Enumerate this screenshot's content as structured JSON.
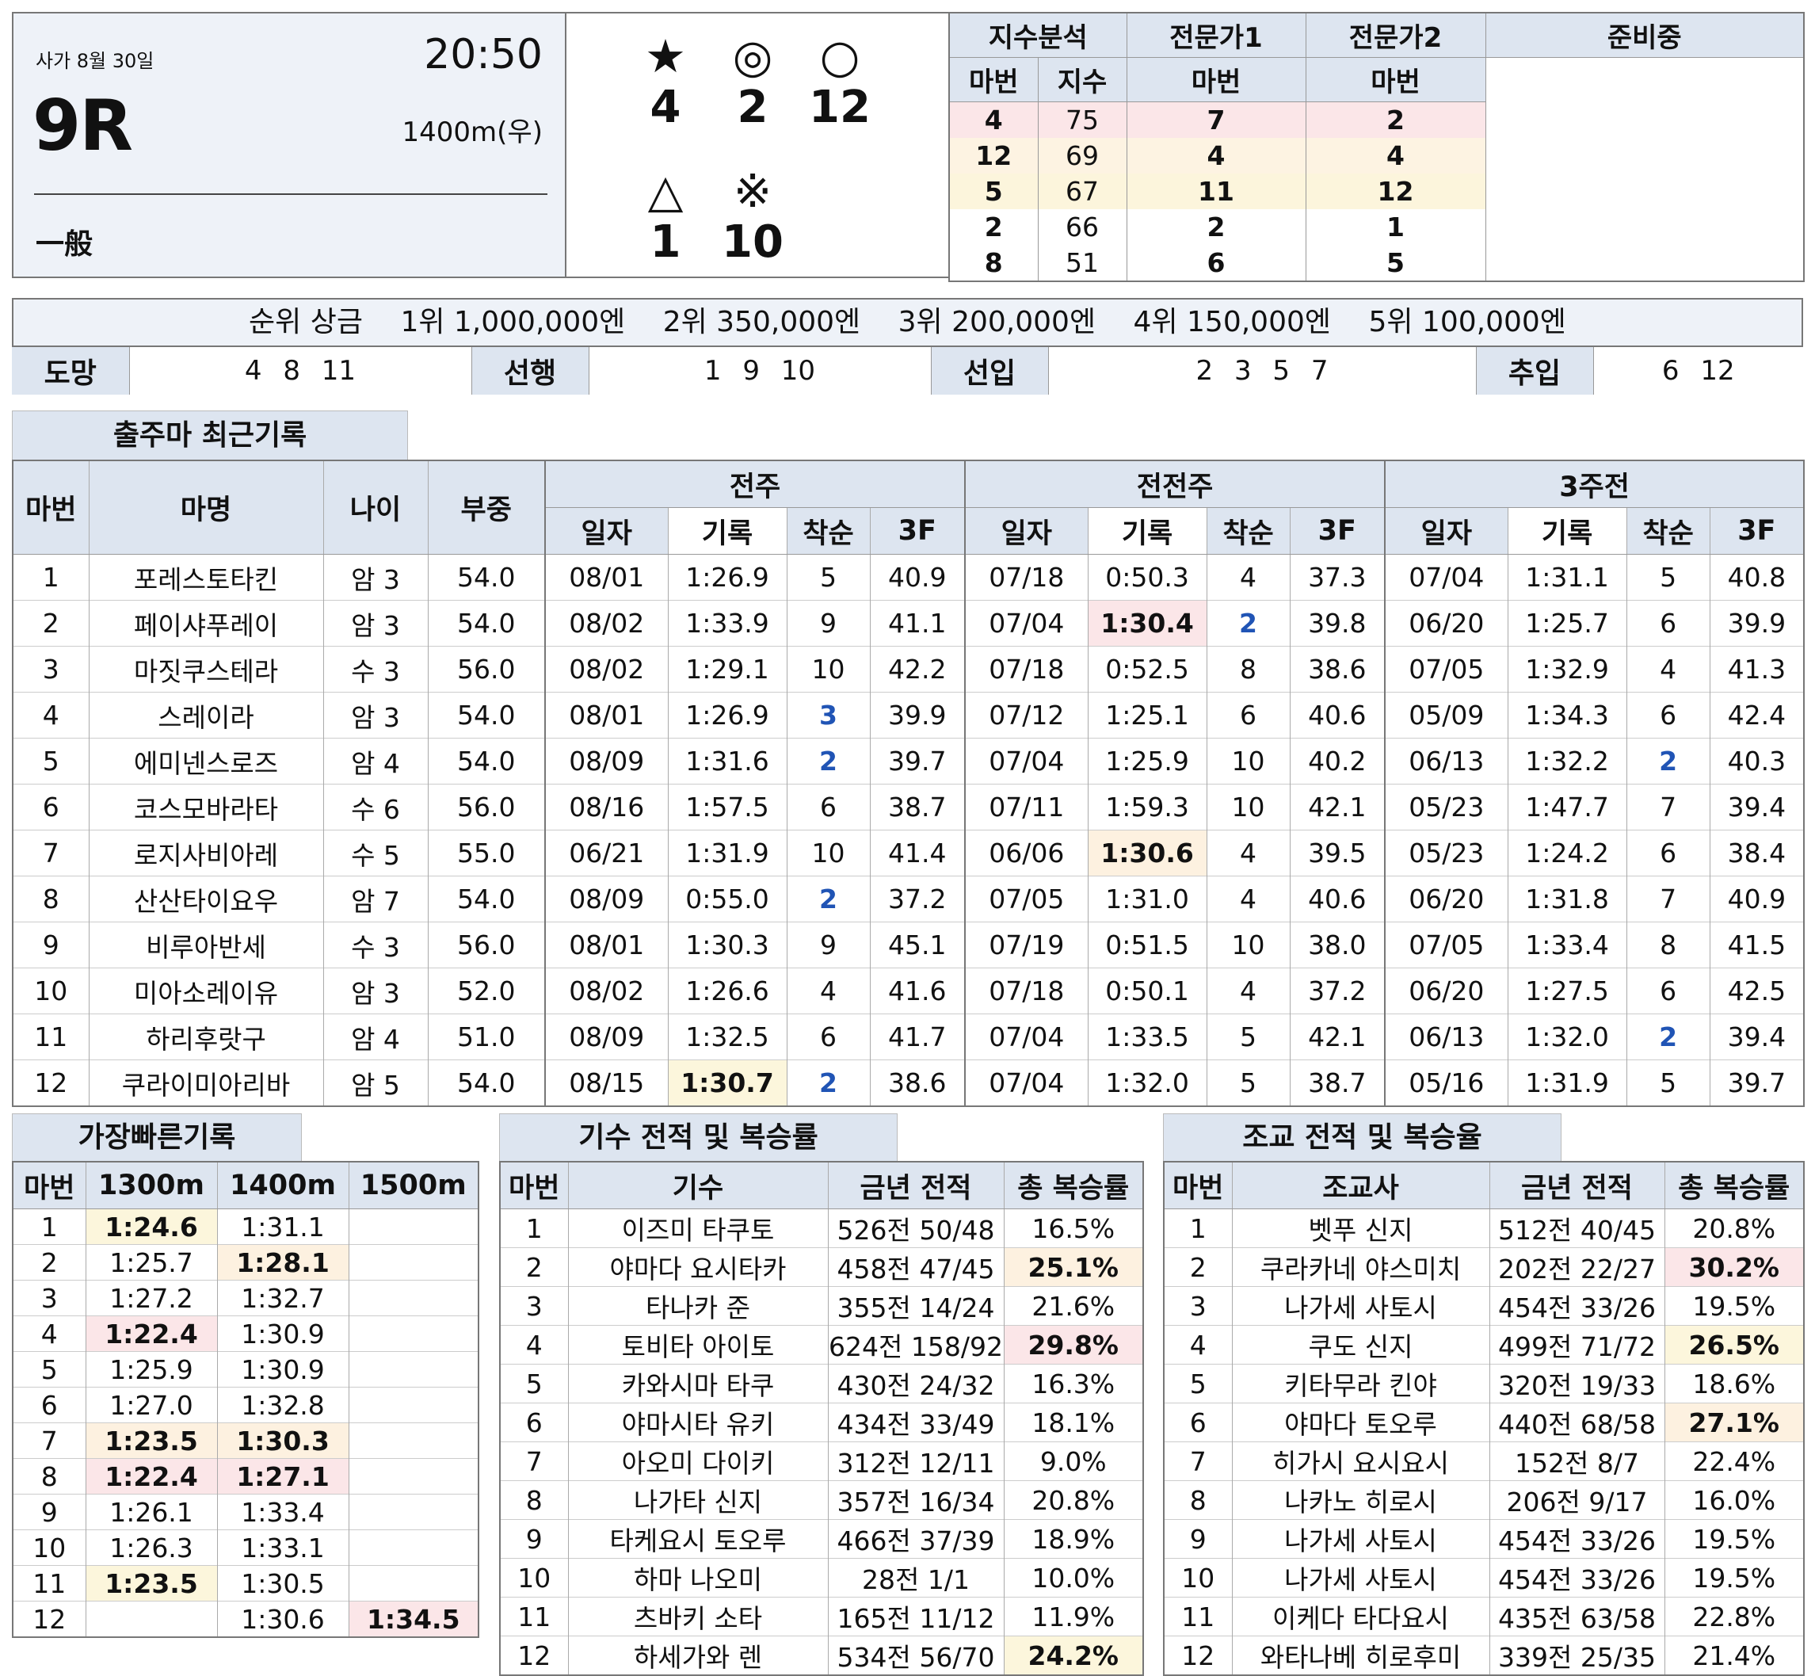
{
  "race": {
    "place_date": "사가 8월 30일",
    "time": "20:50",
    "race_no": "9R",
    "distance": "1400m(우)",
    "class": "一般"
  },
  "picks": {
    "row1": [
      {
        "symbol": "★",
        "num": "4"
      },
      {
        "symbol": "◎",
        "num": "2"
      },
      {
        "symbol": "○",
        "num": "12"
      }
    ],
    "row2": [
      {
        "symbol": "△",
        "num": "1"
      },
      {
        "symbol": "※",
        "num": "10"
      }
    ]
  },
  "index": {
    "headers": [
      "지수분석",
      "전문가1",
      "전문가2",
      "준비중"
    ],
    "sub_headers": [
      "마번",
      "지수",
      "마번",
      "마번"
    ],
    "rows": [
      {
        "no": "4",
        "score": "75",
        "e1": "7",
        "e2": "2"
      },
      {
        "no": "12",
        "score": "69",
        "e1": "4",
        "e2": "4"
      },
      {
        "no": "5",
        "score": "67",
        "e1": "11",
        "e2": "12"
      },
      {
        "no": "2",
        "score": "66",
        "e1": "2",
        "e2": "1"
      },
      {
        "no": "8",
        "score": "51",
        "e1": "6",
        "e2": "5"
      }
    ]
  },
  "prize": {
    "label": "순위 상금",
    "items": [
      "1위 1,000,000엔",
      "2위 350,000엔",
      "3위 200,000엔",
      "4위 150,000엔",
      "5위 100,000엔"
    ]
  },
  "styles": [
    {
      "label": "도망",
      "value": "4 8 11"
    },
    {
      "label": "선행",
      "value": "1 9 10"
    },
    {
      "label": "선입",
      "value": "2 3 5 7"
    },
    {
      "label": "추입",
      "value": "6 12"
    }
  ],
  "recent": {
    "tab": "출주마 최근기록",
    "headers": {
      "no": "마번",
      "name": "마명",
      "age": "나이",
      "weight": "부중",
      "groups": [
        "전주",
        "전전주",
        "3주전"
      ],
      "sub": [
        "일자",
        "기록",
        "착순",
        "3F"
      ]
    },
    "rows": [
      {
        "no": "1",
        "name": "포레스토타킨",
        "age": "암 3",
        "wt": "54.0",
        "r": [
          [
            "08/01",
            "1:26.9",
            "5",
            "40.9"
          ],
          [
            "07/18",
            "0:50.3",
            "4",
            "37.3"
          ],
          [
            "07/04",
            "1:31.1",
            "5",
            "40.8"
          ]
        ]
      },
      {
        "no": "2",
        "name": "페이샤푸레이",
        "age": "암 3",
        "wt": "54.0",
        "r": [
          [
            "08/02",
            "1:33.9",
            "9",
            "41.1"
          ],
          [
            "07/04",
            "1:30.4",
            "2",
            "39.8"
          ],
          [
            "06/20",
            "1:25.7",
            "6",
            "39.9"
          ]
        ]
      },
      {
        "no": "3",
        "name": "마짓쿠스테라",
        "age": "수 3",
        "wt": "56.0",
        "r": [
          [
            "08/02",
            "1:29.1",
            "10",
            "42.2"
          ],
          [
            "07/18",
            "0:52.5",
            "8",
            "38.6"
          ],
          [
            "07/05",
            "1:32.9",
            "4",
            "41.3"
          ]
        ]
      },
      {
        "no": "4",
        "name": "스레이라",
        "age": "암 3",
        "wt": "54.0",
        "r": [
          [
            "08/01",
            "1:26.9",
            "3",
            "39.9"
          ],
          [
            "07/12",
            "1:25.1",
            "6",
            "40.6"
          ],
          [
            "05/09",
            "1:34.3",
            "6",
            "42.4"
          ]
        ]
      },
      {
        "no": "5",
        "name": "에미넨스로즈",
        "age": "암 4",
        "wt": "54.0",
        "r": [
          [
            "08/09",
            "1:31.6",
            "2",
            "39.7"
          ],
          [
            "07/04",
            "1:25.9",
            "10",
            "40.2"
          ],
          [
            "06/13",
            "1:32.2",
            "2",
            "40.3"
          ]
        ]
      },
      {
        "no": "6",
        "name": "코스모바라타",
        "age": "수 6",
        "wt": "56.0",
        "r": [
          [
            "08/16",
            "1:57.5",
            "6",
            "38.7"
          ],
          [
            "07/11",
            "1:59.3",
            "10",
            "42.1"
          ],
          [
            "05/23",
            "1:47.7",
            "7",
            "39.4"
          ]
        ]
      },
      {
        "no": "7",
        "name": "로지사비아레",
        "age": "수 5",
        "wt": "55.0",
        "r": [
          [
            "06/21",
            "1:31.9",
            "10",
            "41.4"
          ],
          [
            "06/06",
            "1:30.6",
            "4",
            "39.5"
          ],
          [
            "05/23",
            "1:24.2",
            "6",
            "38.4"
          ]
        ]
      },
      {
        "no": "8",
        "name": "산산타이요우",
        "age": "암 7",
        "wt": "54.0",
        "r": [
          [
            "08/09",
            "0:55.0",
            "2",
            "37.2"
          ],
          [
            "07/05",
            "1:31.0",
            "4",
            "40.6"
          ],
          [
            "06/20",
            "1:31.8",
            "7",
            "40.9"
          ]
        ]
      },
      {
        "no": "9",
        "name": "비루아반세",
        "age": "수 3",
        "wt": "56.0",
        "r": [
          [
            "08/01",
            "1:30.3",
            "9",
            "45.1"
          ],
          [
            "07/19",
            "0:51.5",
            "10",
            "38.0"
          ],
          [
            "07/05",
            "1:33.4",
            "8",
            "41.5"
          ]
        ]
      },
      {
        "no": "10",
        "name": "미아소레이유",
        "age": "암 3",
        "wt": "52.0",
        "r": [
          [
            "08/02",
            "1:26.6",
            "4",
            "41.6"
          ],
          [
            "07/18",
            "0:50.1",
            "4",
            "37.2"
          ],
          [
            "06/20",
            "1:27.5",
            "6",
            "42.5"
          ]
        ]
      },
      {
        "no": "11",
        "name": "하리후랏구",
        "age": "암 4",
        "wt": "51.0",
        "r": [
          [
            "08/09",
            "1:32.5",
            "6",
            "41.7"
          ],
          [
            "07/04",
            "1:33.5",
            "5",
            "42.1"
          ],
          [
            "06/13",
            "1:32.0",
            "2",
            "39.4"
          ]
        ]
      },
      {
        "no": "12",
        "name": "쿠라이미아리바",
        "age": "암 5",
        "wt": "54.0",
        "r": [
          [
            "08/15",
            "1:30.7",
            "2",
            "38.6"
          ],
          [
            "07/04",
            "1:32.0",
            "5",
            "38.7"
          ],
          [
            "05/16",
            "1:31.9",
            "5",
            "39.7"
          ]
        ]
      }
    ]
  },
  "fastest": {
    "tab": "가장빠른기록",
    "headers": [
      "마번",
      "1300m",
      "1400m",
      "1500m"
    ],
    "rows": [
      [
        "1",
        "1:24.6",
        "1:31.1",
        ""
      ],
      [
        "2",
        "1:25.7",
        "1:28.1",
        ""
      ],
      [
        "3",
        "1:27.2",
        "1:32.7",
        ""
      ],
      [
        "4",
        "1:22.4",
        "1:30.9",
        ""
      ],
      [
        "5",
        "1:25.9",
        "1:30.9",
        ""
      ],
      [
        "6",
        "1:27.0",
        "1:32.8",
        ""
      ],
      [
        "7",
        "1:23.5",
        "1:30.3",
        ""
      ],
      [
        "8",
        "1:22.4",
        "1:27.1",
        ""
      ],
      [
        "9",
        "1:26.1",
        "1:33.4",
        ""
      ],
      [
        "10",
        "1:26.3",
        "1:33.1",
        ""
      ],
      [
        "11",
        "1:23.5",
        "1:30.5",
        ""
      ],
      [
        "12",
        "",
        "1:30.6",
        "1:34.5"
      ]
    ]
  },
  "jockey": {
    "tab": "기수 전적 및 복승률",
    "headers": [
      "마번",
      "기수",
      "금년 전적",
      "총 복승률"
    ],
    "rows": [
      [
        "1",
        "이즈미 타쿠토",
        "526전 50/48",
        "16.5%"
      ],
      [
        "2",
        "야마다 요시타카",
        "458전 47/45",
        "25.1%"
      ],
      [
        "3",
        "타나카 준",
        "355전 14/24",
        "21.6%"
      ],
      [
        "4",
        "토비타 아이토",
        "624전 158/92",
        "29.8%"
      ],
      [
        "5",
        "카와시마 타쿠",
        "430전 24/32",
        "16.3%"
      ],
      [
        "6",
        "야마시타 유키",
        "434전 33/49",
        "18.1%"
      ],
      [
        "7",
        "아오미 다이키",
        "312전 12/11",
        "9.0%"
      ],
      [
        "8",
        "나가타 신지",
        "357전 16/34",
        "20.8%"
      ],
      [
        "9",
        "타케요시 토오루",
        "466전 37/39",
        "18.9%"
      ],
      [
        "10",
        "하마 나오미",
        "28전 1/1",
        "10.0%"
      ],
      [
        "11",
        "츠바키 소타",
        "165전 11/12",
        "11.9%"
      ],
      [
        "12",
        "하세가와 렌",
        "534전 56/70",
        "24.2%"
      ]
    ]
  },
  "trainer": {
    "tab": "조교 전적 및 복승율",
    "headers": [
      "마번",
      "조교사",
      "금년 전적",
      "총 복승률"
    ],
    "rows": [
      [
        "1",
        "벳푸 신지",
        "512전 40/45",
        "20.8%"
      ],
      [
        "2",
        "쿠라카네 야스미치",
        "202전 22/27",
        "30.2%"
      ],
      [
        "3",
        "나가세 사토시",
        "454전 33/26",
        "19.5%"
      ],
      [
        "4",
        "쿠도 신지",
        "499전 71/72",
        "26.5%"
      ],
      [
        "5",
        "키타무라 킨야",
        "320전 19/33",
        "18.6%"
      ],
      [
        "6",
        "야마다 토오루",
        "440전 68/58",
        "27.1%"
      ],
      [
        "7",
        "히가시 요시요시",
        "152전 8/7",
        "22.4%"
      ],
      [
        "8",
        "나카노 히로시",
        "206전 9/17",
        "16.0%"
      ],
      [
        "9",
        "나가세 사토시",
        "454전 33/26",
        "19.5%"
      ],
      [
        "10",
        "나가세 사토시",
        "454전 33/26",
        "19.5%"
      ],
      [
        "11",
        "이케다 타다요시",
        "435전 63/58",
        "22.8%"
      ],
      [
        "12",
        "와타나베 히로후미",
        "339전 25/35",
        "21.4%"
      ]
    ]
  },
  "colors": {
    "header_bg": "#dde5f0",
    "pink": "#fbe6e8",
    "cream": "#fdf1e0",
    "yellow": "#fcf6dc",
    "blue_text": "#2054b5"
  }
}
